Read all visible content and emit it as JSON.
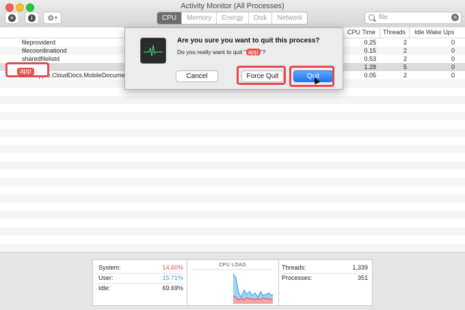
{
  "window": {
    "title": "Activity Monitor (All Processes)"
  },
  "toolbar": {
    "close_icon": "x-circle-icon",
    "info_icon": "info-icon",
    "gear_icon": "gear-icon",
    "tabs": [
      {
        "label": "CPU"
      },
      {
        "label": "Memory"
      },
      {
        "label": "Energy"
      },
      {
        "label": "Disk"
      },
      {
        "label": "Network"
      }
    ],
    "search": {
      "value": "file",
      "placeholder": "Search"
    }
  },
  "table": {
    "columns": {
      "cpu_time": "CPU Time",
      "threads": "Threads",
      "idle_wake_ups": "Idle Wake Ups"
    },
    "rows": [
      {
        "name": "fileproviderd",
        "cpu_time": "0.25",
        "threads": "2",
        "idle": "0"
      },
      {
        "name": "filecoordinationd",
        "cpu_time": "0.15",
        "threads": "2",
        "idle": "0"
      },
      {
        "name": "sharedfilelistd",
        "cpu_time": "0.53",
        "threads": "2",
        "idle": "0"
      },
      {
        "name": "app",
        "cpu_time": "1.28",
        "threads": "5",
        "idle": "0"
      },
      {
        "name": "com.apple.CloudDocs.MobileDocuments",
        "cpu_time": "0.05",
        "threads": "2",
        "idle": "0"
      }
    ]
  },
  "dialog": {
    "title": "Are you sure you want to quit this process?",
    "msg_prefix": "Do you really want to quit “",
    "app_name": "app",
    "msg_suffix": "”?",
    "cancel": "Cancel",
    "force_quit": "Force Quit",
    "quit": "Quit"
  },
  "footer": {
    "system_label": "System:",
    "system_value": "14.60%",
    "user_label": "User:",
    "user_value": "15.71%",
    "idle_label": "Idle:",
    "idle_value": "69.69%",
    "cpu_load_label": "CPU LOAD",
    "threads_label": "Threads:",
    "threads_value": "1,339",
    "processes_label": "Processes:",
    "processes_value": "351"
  },
  "colors": {
    "system": "#e5484d",
    "user": "#2c9be0",
    "accent": "#1f78f2"
  }
}
